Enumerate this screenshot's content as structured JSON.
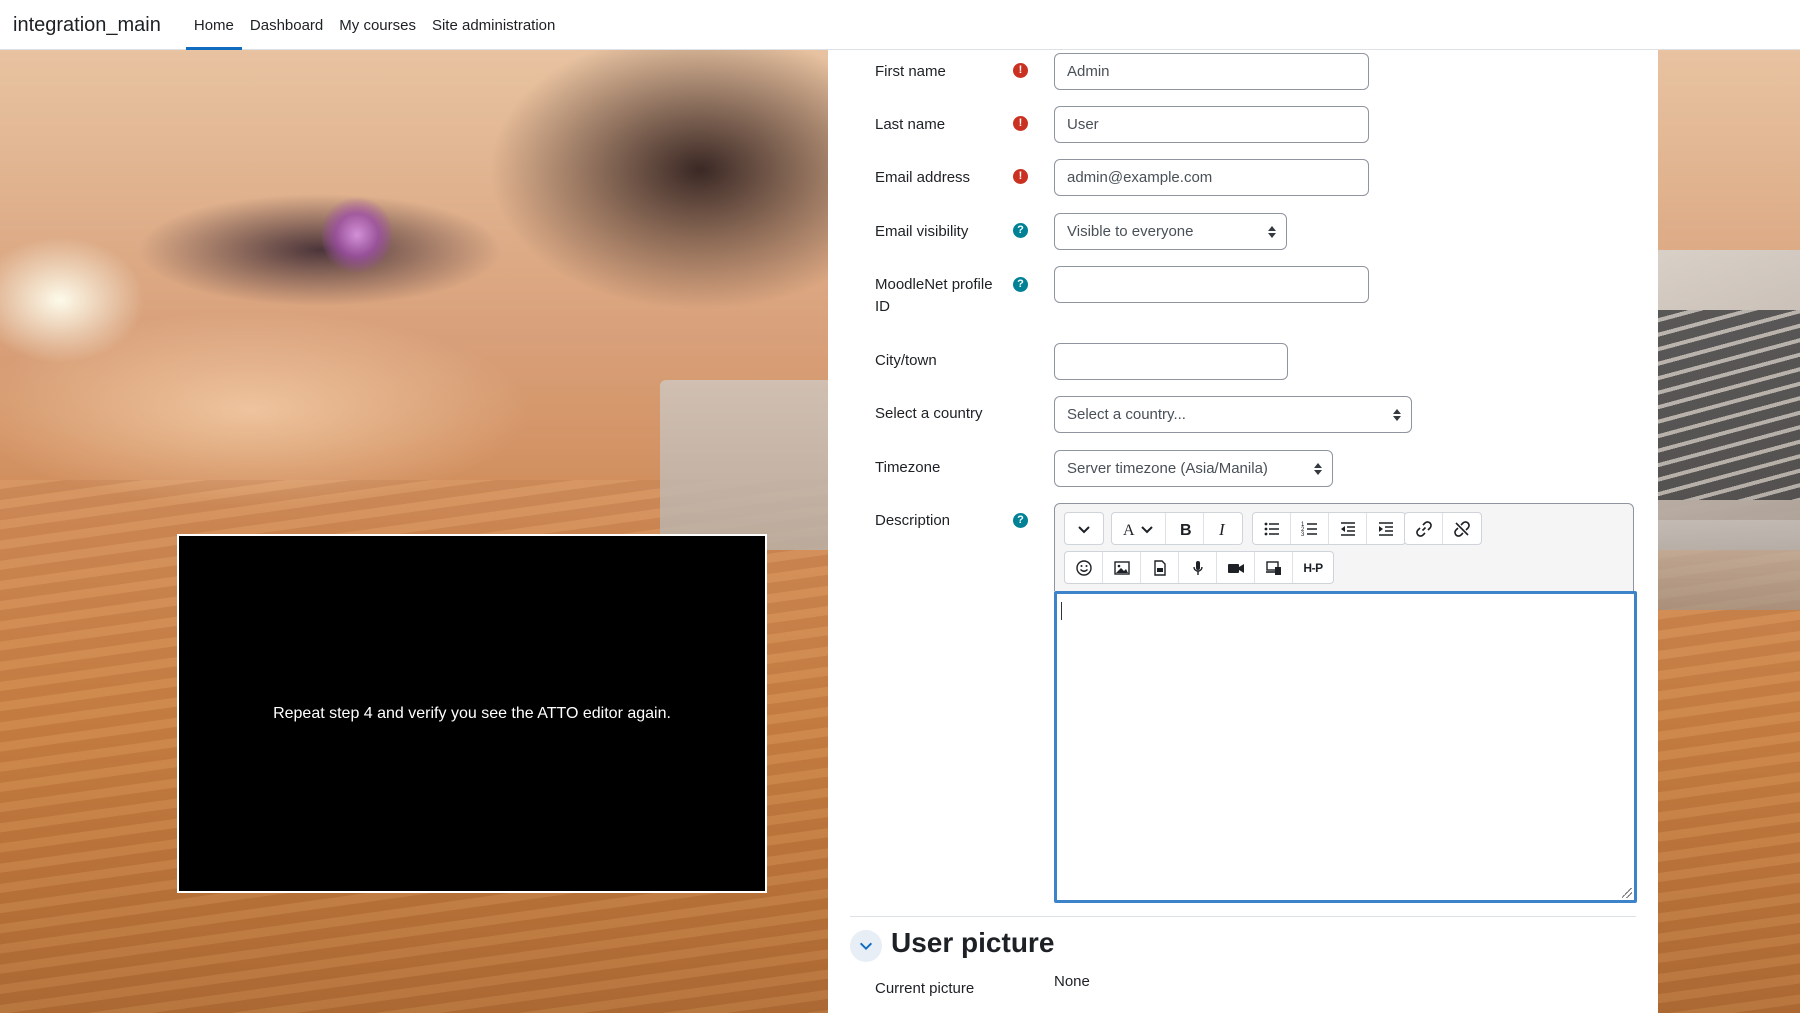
{
  "navbar": {
    "brand": "integration_main",
    "items": [
      {
        "label": "Home",
        "active": true
      },
      {
        "label": "Dashboard",
        "active": false
      },
      {
        "label": "My courses",
        "active": false
      },
      {
        "label": "Site administration",
        "active": false
      }
    ]
  },
  "form": {
    "first_name": {
      "label": "First name",
      "value": "Admin",
      "status": "required"
    },
    "last_name": {
      "label": "Last name",
      "value": "User",
      "status": "required"
    },
    "email": {
      "label": "Email address",
      "value": "admin@example.com",
      "status": "required"
    },
    "email_visibility": {
      "label": "Email visibility",
      "value": "Visible to everyone",
      "status": "help"
    },
    "moodlenet": {
      "label": "MoodleNet profile ID",
      "value": "",
      "status": "help"
    },
    "city": {
      "label": "City/town",
      "value": ""
    },
    "country": {
      "label": "Select a country",
      "value": "Select a country..."
    },
    "timezone": {
      "label": "Timezone",
      "value": "Server timezone (Asia/Manila)"
    },
    "description": {
      "label": "Description",
      "status": "help"
    }
  },
  "editor": {
    "row1": [
      "collapse-icon",
      "font-color-icon",
      "bold-icon",
      "italic-icon",
      "unordered-list-icon",
      "ordered-list-icon",
      "outdent-icon",
      "indent-icon",
      "link-icon",
      "unlink-icon"
    ],
    "row2": [
      "emoji-icon",
      "image-icon",
      "media-file-icon",
      "record-audio-icon",
      "record-video-icon",
      "manage-files-icon",
      "h5p-icon"
    ],
    "h5p_label": "H-P"
  },
  "user_picture": {
    "section_title": "User picture",
    "current_label": "Current picture",
    "current_value": "None"
  },
  "overlay": {
    "message": "Repeat step 4 and verify you see the ATTO editor again."
  },
  "colors": {
    "required": "#ca3120",
    "help": "#008196",
    "accent": "#0f6cbf",
    "focus_border": "#3c83c9"
  }
}
